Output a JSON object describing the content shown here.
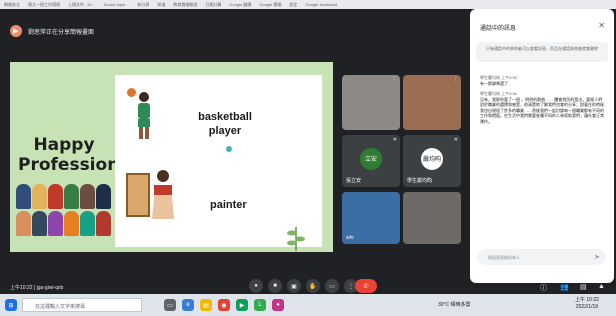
{
  "browser": {
    "bookmarks": [
      "網路安全",
      "建立一個工作環境",
      "上傳文件 - Dr…",
      "Sound Input…",
      "新分頁",
      "知道",
      "教育雲端帳號",
      "日期計算",
      "Google 翻譯",
      "Google 雲端",
      "設定",
      "Google Jamboard"
    ]
  },
  "presenter": {
    "label": "劉思萍正在分享簡報畫面"
  },
  "slide": {
    "title_line1": "Happy",
    "title_line2": "Profession",
    "basketball_label": "basketball player",
    "painter_label": "painter"
  },
  "tiles": [
    {
      "name": "",
      "kind": "video"
    },
    {
      "name": "",
      "kind": "video"
    },
    {
      "name": "張立安",
      "kind": "avatar",
      "initial": "立安",
      "color": "#2e7d32"
    },
    {
      "name": "學生嚴均昀",
      "kind": "avatar",
      "initial": "嚴均昀",
      "color": "#ffffff"
    },
    {
      "name": "whi",
      "kind": "video"
    },
    {
      "name": "",
      "kind": "video"
    }
  ],
  "chat": {
    "title": "通話中的訊息",
    "note": "只有通話中的參與者可以查看訊息，而且在通話結束後就會刪除",
    "messages": [
      {
        "sender": "學生嚴均昀",
        "time": "上午9:55",
        "text": "有一節課嗎還了"
      },
      {
        "sender": "學生嚴均昀",
        "time": "上午9:56",
        "text": "沒有，我那你要了一個 。明明的歌曲…… 體會到民的是出，要經人們對於職業的選擇和感受，很清楚地了解我們也會的分享；說著在的時候我也出現過了許多的職業……然後我們一起討論每一個職業都有不同的工作和價值，在生活中我們需要各種不同的人來幫助我們，讓社會正常運作。"
      }
    ],
    "input_placeholder": "傳送訊息給所有人"
  },
  "controls": {
    "time": "上午10:22",
    "meeting_code": "jga-giwi-qxb"
  },
  "taskbar": {
    "search_placeholder": "在這裡輸入文字來搜尋",
    "weather": "30°C 晴時多雲",
    "clock_time": "上午 10:22",
    "clock_date": "2022/1/19"
  }
}
